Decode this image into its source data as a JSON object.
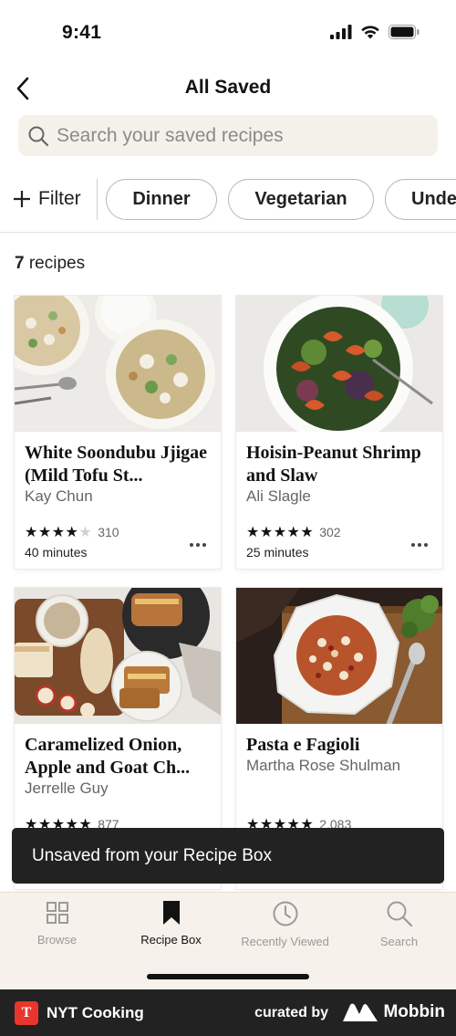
{
  "status_bar": {
    "time": "9:41"
  },
  "header": {
    "title": "All Saved"
  },
  "search": {
    "placeholder": "Search your saved recipes"
  },
  "filters": {
    "filter_label": "Filter",
    "chips": [
      "Dinner",
      "Vegetarian",
      "Unde"
    ]
  },
  "results": {
    "count": "7",
    "count_suffix": " recipes"
  },
  "recipes": [
    {
      "title": "White Soondubu Jjigae (Mild Tofu St...",
      "author": "Kay Chun",
      "stars": "★★★★★",
      "rating": 4,
      "rating_count": "310",
      "time": "40 minutes"
    },
    {
      "title": "Hoisin-Peanut Shrimp and Slaw",
      "author": "Ali Slagle",
      "stars": "★★★★★",
      "rating": 5,
      "rating_count": "302",
      "time": "25 minutes"
    },
    {
      "title": "Caramelized Onion, Apple and Goat Ch...",
      "author": "Jerrelle Guy",
      "stars": "★★★★★",
      "rating": 5,
      "rating_count": "877",
      "time": ""
    },
    {
      "title": "Pasta e Fagioli",
      "author": "Martha Rose Shulman",
      "stars": "★★★★★",
      "rating": 5,
      "rating_count": "2,083",
      "time": ""
    }
  ],
  "toast": {
    "message": "Unsaved from your Recipe Box"
  },
  "tab_bar": {
    "tabs": [
      {
        "label": "Browse",
        "icon": "grid-icon",
        "active": false
      },
      {
        "label": "Recipe Box",
        "icon": "bookmark-icon",
        "active": true
      },
      {
        "label": "Recently Viewed",
        "icon": "clock-icon",
        "active": false
      },
      {
        "label": "Search",
        "icon": "search-icon",
        "active": false
      }
    ]
  },
  "brand_bar": {
    "app_name": "NYT Cooking",
    "logo_glyph": "T",
    "curated_by": "curated by",
    "mobbin": "Mobbin"
  },
  "colors": {
    "accent_red": "#e8362c",
    "dark": "#222222",
    "tab_bg": "#f6f1ea",
    "search_bg": "#f3f1ea"
  }
}
